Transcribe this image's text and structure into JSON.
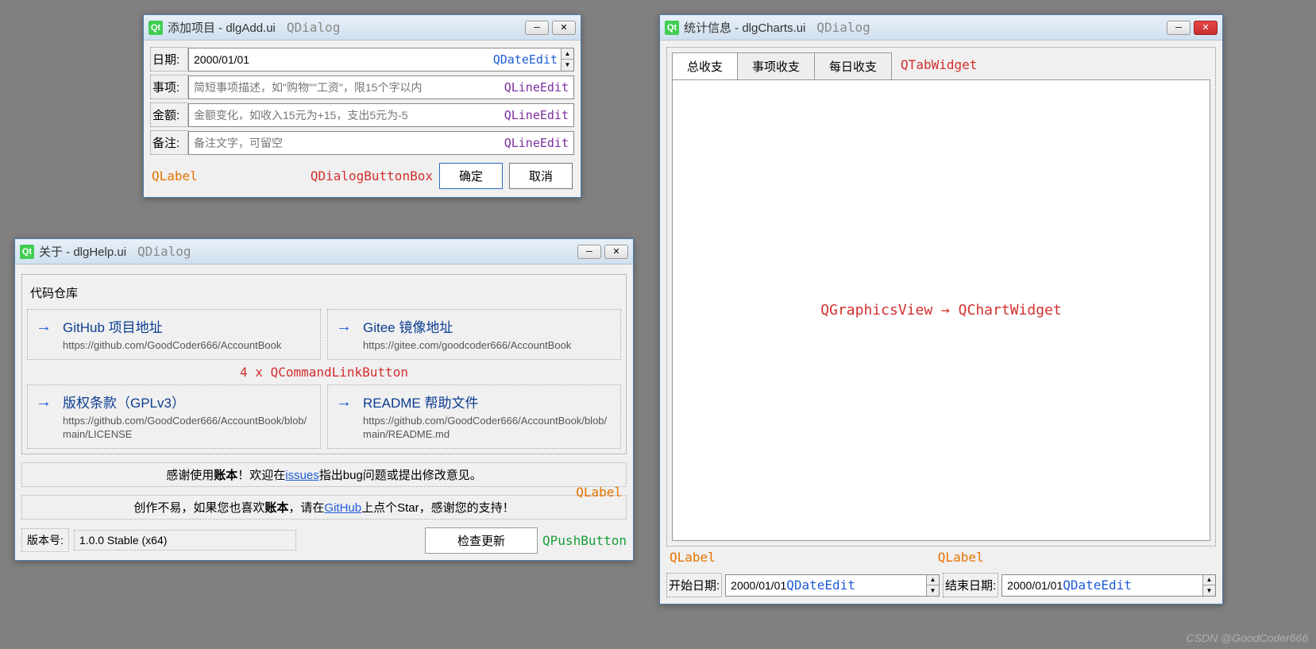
{
  "dlgAdd": {
    "title": "添加项目 - dlgAdd.ui",
    "classHint": "QDialog",
    "labels": {
      "date": "日期:",
      "item": "事项:",
      "amount": "金额:",
      "note": "备注:"
    },
    "dateValue": "2000/01/01",
    "dateHint": "QDateEdit",
    "itemPlaceholder": "简短事项描述，如\"购物\"\"工资\"，限15个字以内",
    "itemHint": "QLineEdit",
    "amountPlaceholder": "金额变化，如收入15元为+15，支出5元为-5",
    "amountHint": "QLineEdit",
    "notePlaceholder": "备注文字，可留空",
    "noteHint": "QLineEdit",
    "labelAnnot": "QLabel",
    "buttonBoxAnnot": "QDialogButtonBox",
    "okBtn": "确定",
    "cancelBtn": "取消"
  },
  "dlgHelp": {
    "title": "关于 - dlgHelp.ui",
    "classHint": "QDialog",
    "groupTitle": "代码仓库",
    "cmd1": {
      "title": "GitHub 项目地址",
      "url": "https://github.com/GoodCoder666/AccountBook"
    },
    "cmd2": {
      "title": "Gitee 镜像地址",
      "url": "https://gitee.com/goodcoder666/AccountBook"
    },
    "cmd3": {
      "title": "版权条款（GPLv3）",
      "url": "https://github.com/GoodCoder666/AccountBook/blob/main/LICENSE"
    },
    "cmd4": {
      "title": "README 帮助文件",
      "url": "https://github.com/GoodCoder666/AccountBook/blob/main/README.md"
    },
    "cmdAnnot": "4 x QCommandLinkButton",
    "thanks1_a": "感谢使用",
    "thanks1_b": "账本",
    "thanks1_c": "！欢迎在",
    "thanks1_link": "issues",
    "thanks1_d": "指出bug问题或提出修改意见。",
    "thanks2_a": "创作不易，如果您也喜欢",
    "thanks2_b": "账本",
    "thanks2_c": "，请在",
    "thanks2_link": "GitHub",
    "thanks2_d": "上点个Star，感谢您的支持！",
    "labelAnnot": "QLabel",
    "versionLabel": "版本号:",
    "versionValue": "1.0.0 Stable (x64)",
    "updateBtn": "检查更新",
    "updateAnnot": "QPushButton"
  },
  "dlgCharts": {
    "title": "统计信息 - dlgCharts.ui",
    "classHint": "QDialog",
    "tabs": [
      "总收支",
      "事项收支",
      "每日收支"
    ],
    "tabAnnot": "QTabWidget",
    "chartAnnot": "QGraphicsView → QChartWidget",
    "labelAnnot": "QLabel",
    "startLabel": "开始日期:",
    "endLabel": "结束日期:",
    "startValue": "2000/01/01",
    "endValue": "2000/01/01",
    "dateHint": "QDateEdit"
  },
  "watermark": "CSDN @GoodCoder666"
}
